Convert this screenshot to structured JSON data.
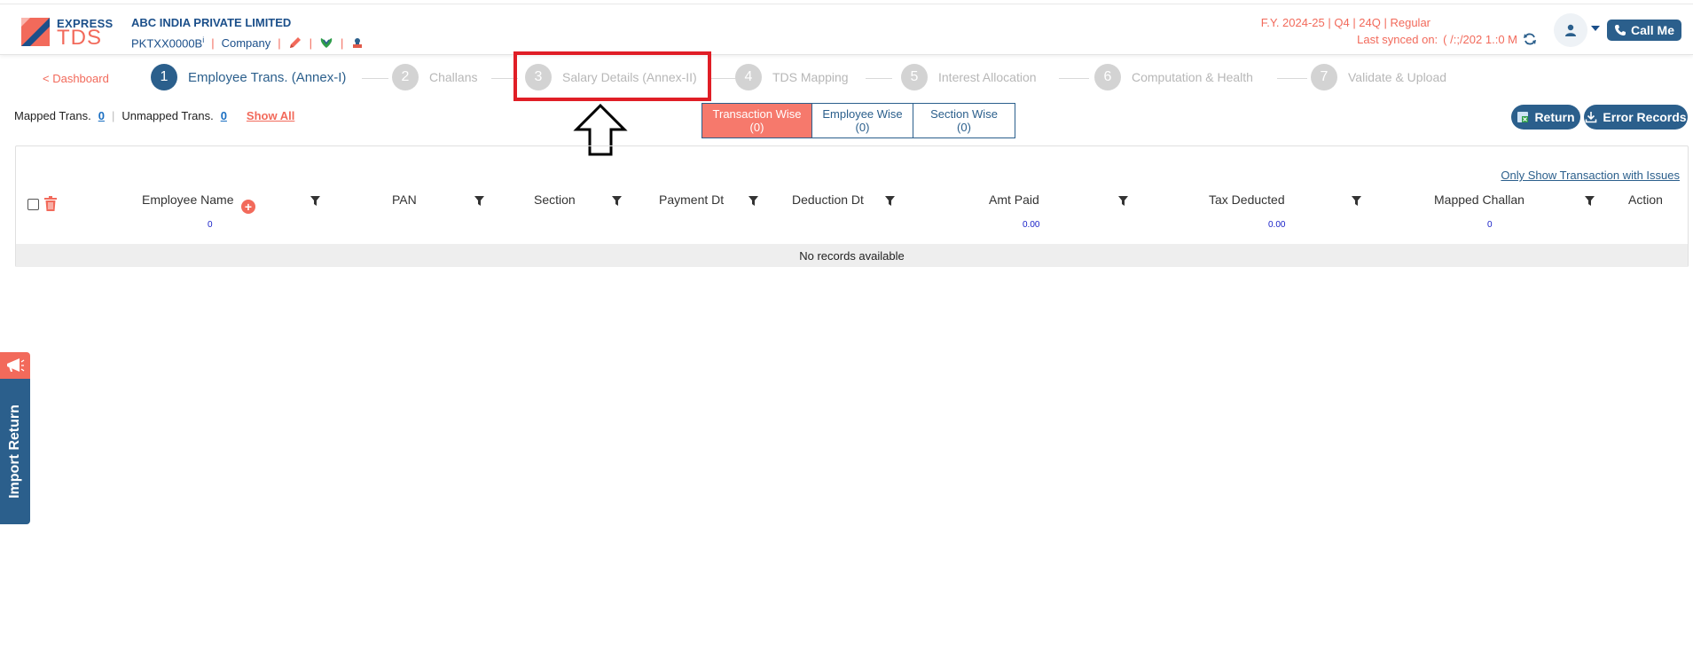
{
  "header": {
    "logo_express": "EXPRESS",
    "logo_tds": "TDS",
    "company_name": "ABC INDIA PRIVATE LIMITED",
    "tan": "PKTXX0000B",
    "info_marker": "i",
    "entity_type": "Company",
    "sep": "|",
    "fy_line": "F.Y. 2024-25  | Q4  | 24Q | Regular",
    "last_synced_label": "Last synced on:",
    "last_synced_value": "( /:;/202 1.:0    M",
    "call_label": "Call Me",
    "accent_color": "#f26a5b",
    "brand_color": "#2b5f8c"
  },
  "nav": {
    "dashboard_link": "< Dashboard",
    "steps": [
      {
        "num": "1",
        "label": "Employee Trans. (Annex-I)"
      },
      {
        "num": "2",
        "label": "Challans"
      },
      {
        "num": "3",
        "label": "Salary Details (Annex-II)"
      },
      {
        "num": "4",
        "label": "TDS Mapping"
      },
      {
        "num": "5",
        "label": "Interest Allocation"
      },
      {
        "num": "6",
        "label": "Computation & Health"
      },
      {
        "num": "7",
        "label": "Validate & Upload"
      }
    ]
  },
  "toolbar": {
    "mapped_label": "Mapped Trans.",
    "mapped_count": "0",
    "unmapped_label": "Unmapped Trans.",
    "unmapped_count": "0",
    "show_all": "Show All",
    "divider": "|",
    "views": [
      {
        "label": "Transaction Wise",
        "count": "(0)"
      },
      {
        "label": "Employee Wise",
        "count": "(0)"
      },
      {
        "label": "Section Wise",
        "count": "(0)"
      }
    ],
    "return_label": "Return",
    "error_records_label": "Error Records"
  },
  "table": {
    "only_issues_link": "Only Show Transaction with Issues",
    "columns": [
      "Employee Name",
      "PAN",
      "Section",
      "Payment Dt",
      "Deduction Dt",
      "Amt Paid",
      "Tax Deducted",
      "Mapped Challan",
      "Action"
    ],
    "sums": {
      "employee_count": "0",
      "amt_paid": "0.00",
      "tax_deducted": "0.00",
      "mapped_challan": "0"
    },
    "empty_message": "No records available"
  },
  "side_tab": {
    "label": "Import Return"
  }
}
